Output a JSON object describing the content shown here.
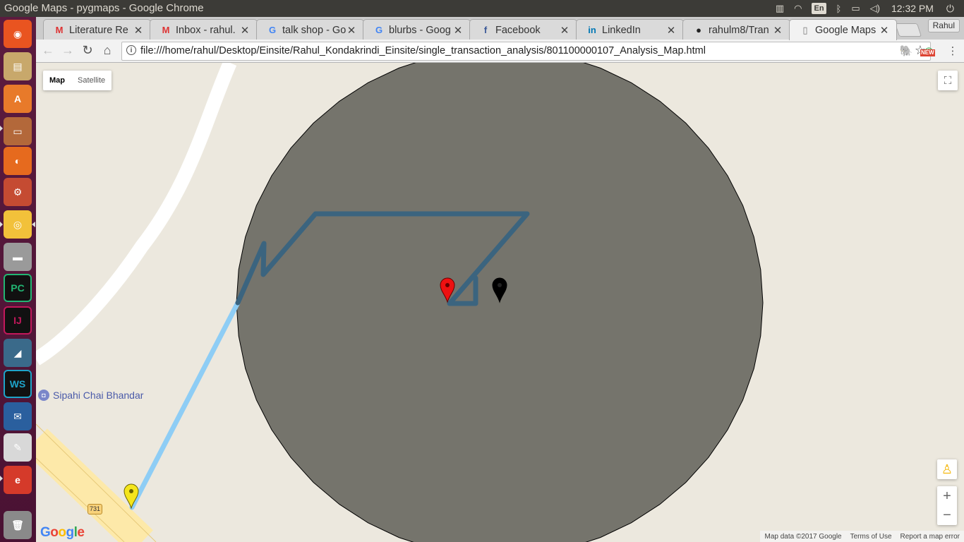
{
  "window": {
    "title": "Google Maps - pygmaps - Google Chrome",
    "keyboard_layout": "En",
    "time": "12:32 PM"
  },
  "launcher": {
    "items": [
      {
        "name": "ubuntu-dash-icon",
        "color": "#e95420",
        "glyph": "◉"
      },
      {
        "name": "files-icon",
        "color": "#c8a86b",
        "glyph": "▤"
      },
      {
        "name": "software-center-icon",
        "color": "#e87a2a",
        "glyph": "A"
      },
      {
        "name": "file-manager-icon",
        "color": "#b3683a",
        "glyph": "▭"
      },
      {
        "name": "firefox-icon",
        "color": "#e66a1e",
        "glyph": "◐"
      },
      {
        "name": "system-settings-icon",
        "color": "#c54b32",
        "glyph": "⚙"
      },
      {
        "name": "chrome-icon",
        "color": "#f2c13a",
        "glyph": "◎"
      },
      {
        "name": "disk-icon",
        "color": "#9a9a9a",
        "glyph": "▬"
      },
      {
        "name": "pycharm-icon",
        "color": "#22b573",
        "glyph": "PC"
      },
      {
        "name": "intellij-icon",
        "color": "#c2185b",
        "glyph": "IJ"
      },
      {
        "name": "mysql-workbench-icon",
        "color": "#3a6a8a",
        "glyph": "◢"
      },
      {
        "name": "webstorm-icon",
        "color": "#1ea3c9",
        "glyph": "WS"
      },
      {
        "name": "thunderbird-icon",
        "color": "#2a5f9e",
        "glyph": "✉"
      },
      {
        "name": "text-editor-icon",
        "color": "#d8d8d8",
        "glyph": "✎"
      },
      {
        "name": "libreoffice-icon",
        "color": "#d53a2a",
        "glyph": "e"
      },
      {
        "name": "trash-icon",
        "color": "#8a8a8a",
        "glyph": "🗑"
      }
    ]
  },
  "tabs": [
    {
      "icon": "gmail-icon",
      "glyph": "M",
      "color": "#d33",
      "label": "Literature Re"
    },
    {
      "icon": "gmail-icon",
      "glyph": "M",
      "color": "#d33",
      "label": "Inbox - rahul."
    },
    {
      "icon": "google-icon",
      "glyph": "G",
      "color": "#4285f4",
      "label": "talk shop - Go"
    },
    {
      "icon": "google-icon",
      "glyph": "G",
      "color": "#4285f4",
      "label": "blurbs - Goog"
    },
    {
      "icon": "facebook-icon",
      "glyph": "f",
      "color": "#3b5998",
      "label": "Facebook"
    },
    {
      "icon": "linkedin-icon",
      "glyph": "in",
      "color": "#0077b5",
      "label": "LinkedIn"
    },
    {
      "icon": "github-icon",
      "glyph": "●",
      "color": "#222",
      "label": "rahulm8/Tran"
    },
    {
      "icon": "page-icon",
      "glyph": "▯",
      "color": "#777",
      "label": "Google Maps"
    }
  ],
  "profile_name": "Rahul",
  "address_bar": {
    "url": "file:///home/rahul/Desktop/Einsite/Rahul_Kondakrindi_Einsite/single_transaction_analysis/801100000107_Analysis_Map.html"
  },
  "extensions": {
    "new_badge": "NEW"
  },
  "map": {
    "map_type_options": [
      "Map",
      "Satellite"
    ],
    "selected_map_type": "Map",
    "poi_label": "Sipahi Chai Bhandar",
    "road_shield": "731",
    "google_logo": [
      "G",
      "o",
      "o",
      "g",
      "l",
      "e"
    ],
    "attribution": [
      "Map data ©2017 Google",
      "Terms of Use",
      "Report a map error"
    ],
    "zoom_in": "+",
    "zoom_out": "−",
    "colors": {
      "background": "#ece8de",
      "circle_fill": "#75746c",
      "path_light": "#8ecdf5",
      "path_dark": "#3b647f",
      "marker_red": "#ee1111",
      "marker_black": "#000000",
      "marker_yellow": "#f4e51c"
    }
  }
}
